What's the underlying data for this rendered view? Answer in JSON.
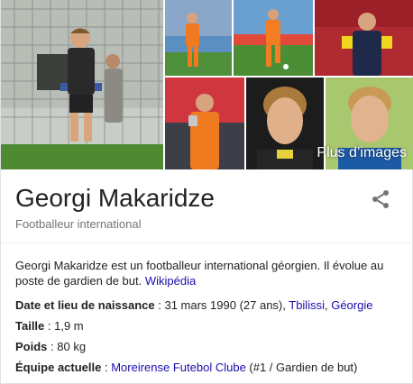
{
  "gallery": {
    "more_label": "Plus d’images"
  },
  "entity": {
    "name": "Georgi Makaridze",
    "type": "Footballeur international"
  },
  "description": {
    "text": "Georgi Makaridze est un footballeur international géorgien. Il évolue au poste de gardien de but. ",
    "source_link": "Wikipédia"
  },
  "facts": {
    "birth": {
      "label": "Date et lieu de naissance",
      "value": " : 31 mars 1990 (27 ans), ",
      "link1": "Tbilissi",
      "sep": ", ",
      "link2": "Géorgie"
    },
    "height": {
      "label": "Taille",
      "value": " : 1,9 m"
    },
    "weight": {
      "label": "Poids",
      "value": " : 80 kg"
    },
    "team": {
      "label": "Équipe actuelle",
      "value_prefix": " : ",
      "link": "Moreirense Futebol Clube",
      "value_suffix": " (#1 / Gardien de but)"
    }
  },
  "colors": {
    "link": "#1a0dab",
    "title": "#222222",
    "subtitle": "#70757a",
    "share_icon": "#70757a"
  }
}
